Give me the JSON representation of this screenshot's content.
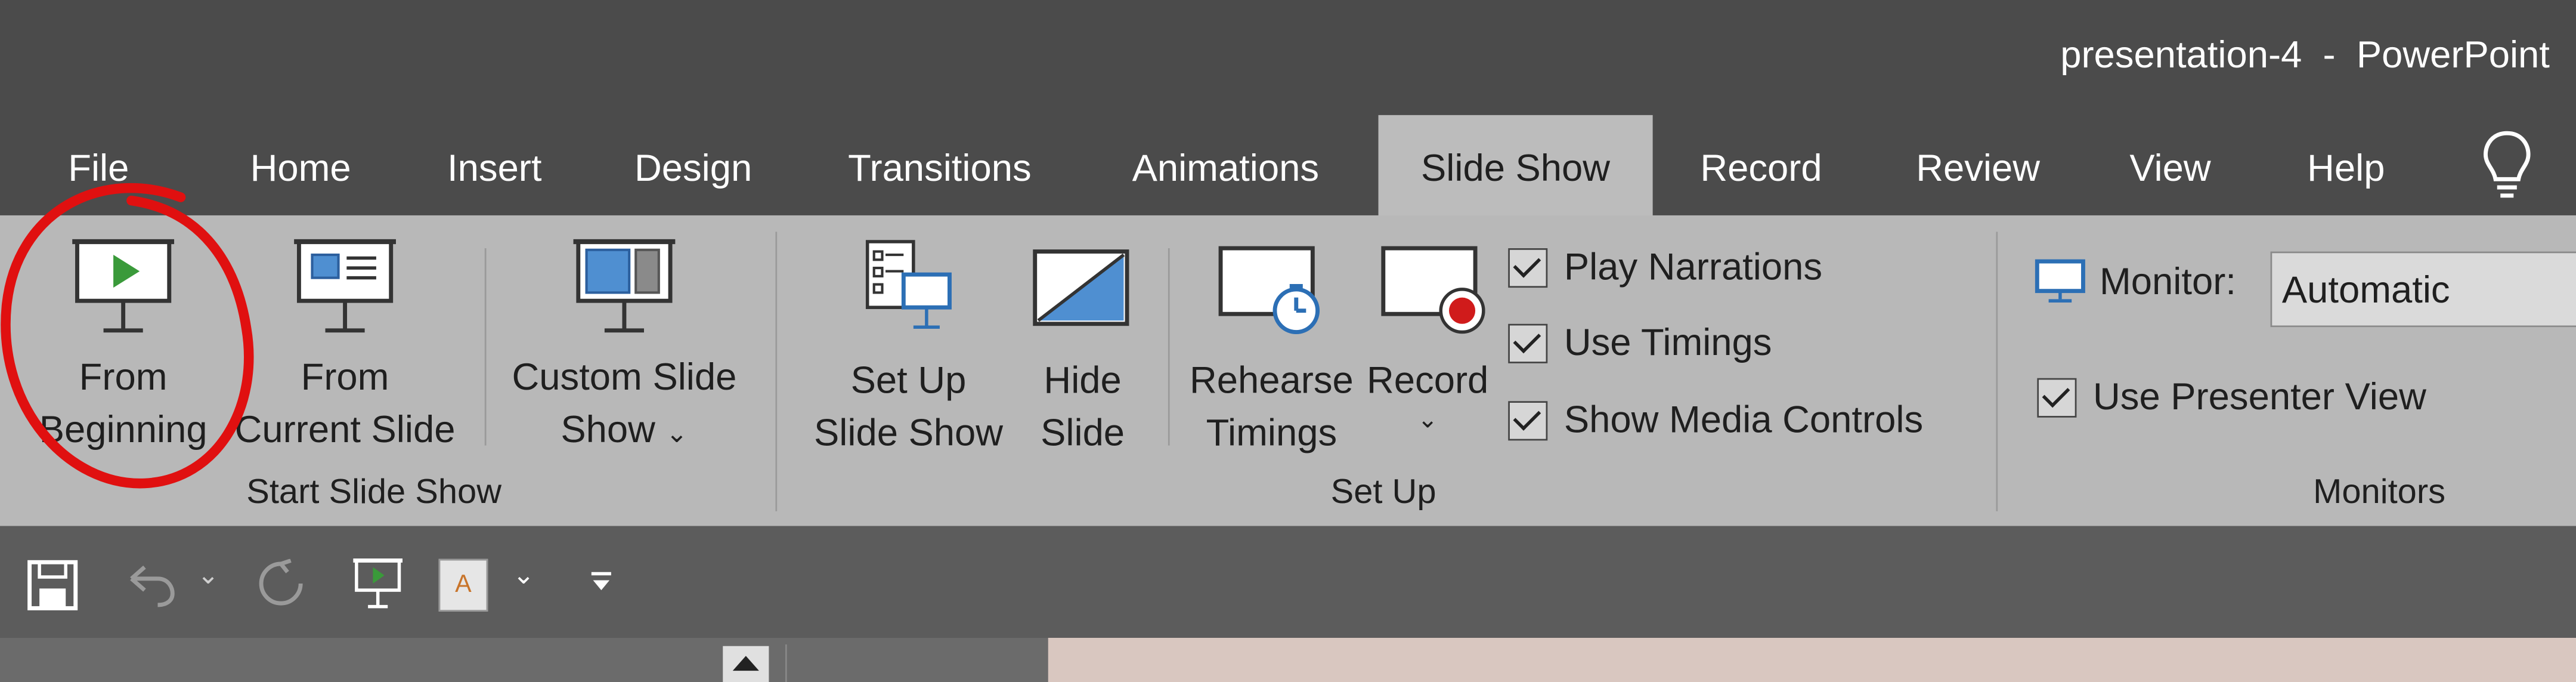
{
  "window": {
    "title": "presentation-4  -  PowerPoint"
  },
  "tabs": [
    {
      "label": "File"
    },
    {
      "label": "Home"
    },
    {
      "label": "Insert"
    },
    {
      "label": "Design"
    },
    {
      "label": "Transitions"
    },
    {
      "label": "Animations"
    },
    {
      "label": "Slide Show",
      "active": true
    },
    {
      "label": "Record"
    },
    {
      "label": "Review"
    },
    {
      "label": "View"
    },
    {
      "label": "Help"
    }
  ],
  "ribbon": {
    "start_group": {
      "label": "Start Slide Show",
      "from_beginning": {
        "line1": "From",
        "line2": "Beginning"
      },
      "from_current": {
        "line1": "From",
        "line2": "Current Slide"
      },
      "custom": {
        "line1": "Custom Slide",
        "line2": "Show",
        "chevron": "⌄"
      }
    },
    "setup_group": {
      "label": "Set Up",
      "setup": {
        "line1": "Set Up",
        "line2": "Slide Show"
      },
      "hide": {
        "line1": "Hide",
        "line2": "Slide"
      },
      "rehearse": {
        "line1": "Rehearse",
        "line2": "Timings"
      },
      "record": {
        "line1": "Record",
        "chevron": "⌄"
      },
      "checks": {
        "play_narrations": "Play Narrations",
        "use_timings": "Use Timings",
        "show_media_controls": "Show Media Controls"
      }
    },
    "monitors_group": {
      "label": "Monitors",
      "monitor_label": "Monitor:",
      "monitor_value": "Automatic",
      "presenter_view": "Use Presenter View"
    }
  },
  "icons": {
    "lightbulb": "lightbulb-icon",
    "save": "save-icon",
    "undo": "undo-icon",
    "redo": "redo-icon",
    "present": "present-from-start-icon",
    "font_color": "font-color-icon",
    "customize": "customize-qat-icon"
  },
  "qat": {
    "undo_chevron": "⌄",
    "font_color_letter": "A",
    "font_chevron": "⌄"
  },
  "colors": {
    "accent_green": "#3a9a3a",
    "screen_blue": "#4f8fd1",
    "annotation_red": "#e01010"
  }
}
